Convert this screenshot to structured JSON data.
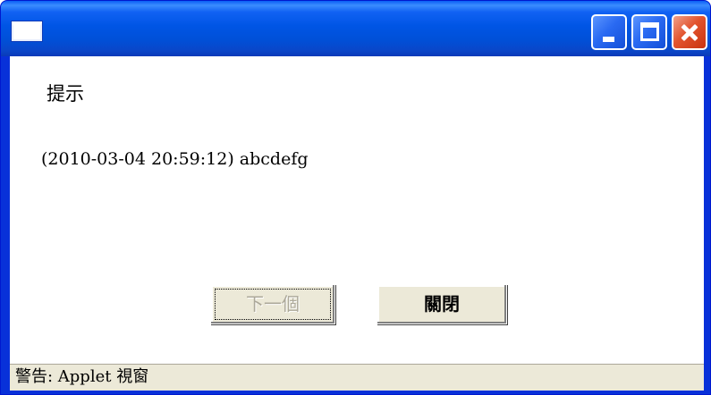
{
  "window": {
    "title": "",
    "icon": "window-icon",
    "controls": {
      "minimize_icon": "minimize-icon",
      "maximize_icon": "maximize-icon",
      "close_icon": "close-icon"
    },
    "colors": {
      "titlebar": "#0055e5",
      "close_button": "#e2542e",
      "face": "#ece9d8"
    }
  },
  "dialog": {
    "title": "提示",
    "message": "(2010-03-04 20:59:12) abcdefg",
    "buttons": {
      "next_label": "下一個",
      "next_enabled": false,
      "close_label": "關閉"
    }
  },
  "status": {
    "text": "警告: Applet 視窗"
  }
}
